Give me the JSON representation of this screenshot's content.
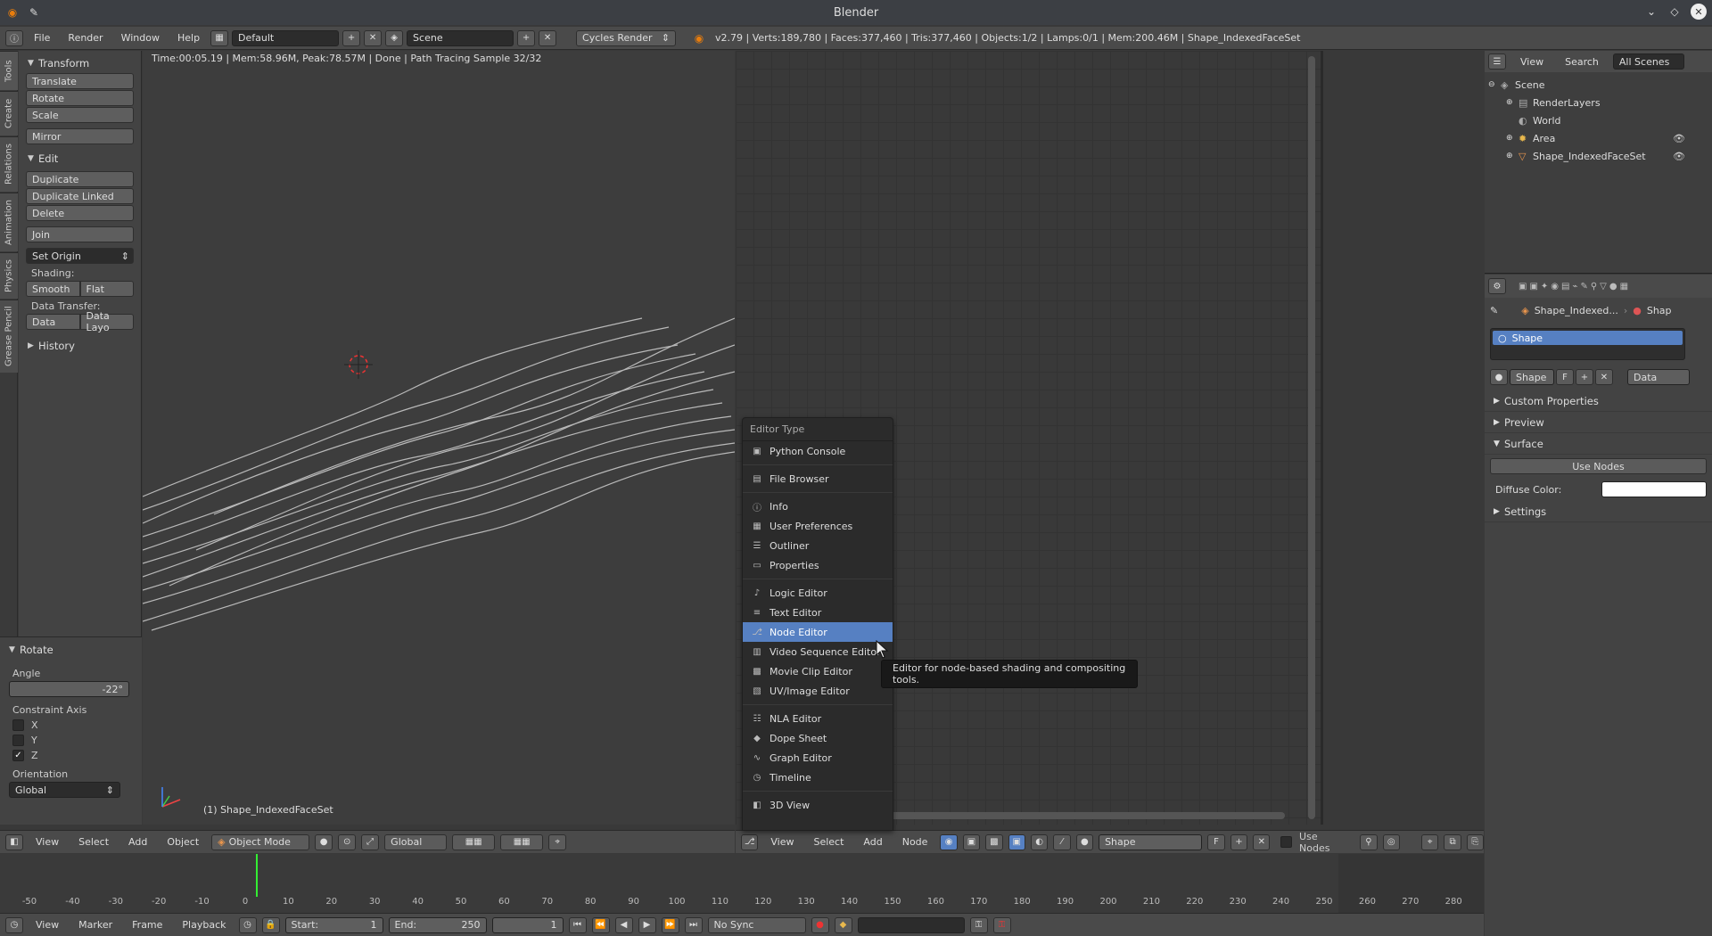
{
  "window": {
    "title": "Blender"
  },
  "menubar": {
    "items": [
      "File",
      "Render",
      "Window",
      "Help"
    ],
    "screen_layout": "Default",
    "scene": "Scene",
    "render_engine": "Cycles Render",
    "stats": "v2.79 | Verts:189,780 | Faces:377,460 | Tris:377,460 | Objects:1/2 | Lamps:0/1 | Mem:200.46M | Shape_IndexedFaceSet"
  },
  "tabs": [
    "Tools",
    "Create",
    "Relations",
    "Animation",
    "Physics",
    "Grease Pencil"
  ],
  "toolshelf": {
    "transform": {
      "title": "Transform",
      "buttons": [
        "Translate",
        "Rotate",
        "Scale",
        "Mirror"
      ]
    },
    "edit": {
      "title": "Edit",
      "buttons": [
        "Duplicate",
        "Duplicate Linked",
        "Delete",
        "Join",
        "Set Origin"
      ]
    },
    "shading_label": "Shading:",
    "shading": [
      "Smooth",
      "Flat"
    ],
    "data_transfer_label": "Data Transfer:",
    "data_transfer": [
      "Data",
      "Data Layo"
    ],
    "history": "History",
    "operator": {
      "title": "Rotate",
      "angle_label": "Angle",
      "angle_value": "-22°",
      "constraint_label": "Constraint Axis",
      "axes": [
        {
          "label": "X",
          "checked": false
        },
        {
          "label": "Y",
          "checked": false
        },
        {
          "label": "Z",
          "checked": true
        }
      ],
      "orientation_label": "Orientation",
      "orientation_value": "Global"
    }
  },
  "viewport": {
    "status": "Time:00:05.19 | Mem:58.96M, Peak:78.57M | Done | Path Tracing Sample 32/32",
    "object_name": "(1) Shape_IndexedFaceSet",
    "header": {
      "menus": [
        "View",
        "Select",
        "Add",
        "Object"
      ],
      "mode": "Object Mode",
      "orientation": "Global"
    }
  },
  "node_editor": {
    "header": {
      "menus": [
        "View",
        "Select",
        "Add",
        "Node"
      ],
      "material": "Shape",
      "f_label": "F",
      "use_nodes": "Use Nodes"
    }
  },
  "editor_menu": {
    "title": "Editor Type",
    "groups": [
      [
        {
          "label": "Python Console",
          "icon": "console-icon"
        }
      ],
      [
        {
          "label": "File Browser",
          "icon": "folder-icon"
        }
      ],
      [
        {
          "label": "Info",
          "icon": "info-icon"
        },
        {
          "label": "User Preferences",
          "icon": "preferences-icon"
        },
        {
          "label": "Outliner",
          "icon": "outliner-icon"
        },
        {
          "label": "Properties",
          "icon": "properties-icon"
        }
      ],
      [
        {
          "label": "Logic Editor",
          "icon": "logic-icon"
        },
        {
          "label": "Text Editor",
          "icon": "text-icon"
        },
        {
          "label": "Node Editor",
          "icon": "node-icon",
          "selected": true
        },
        {
          "label": "Video Sequence Editor",
          "icon": "sequence-icon"
        },
        {
          "label": "Movie Clip Editor",
          "icon": "clip-icon"
        },
        {
          "label": "UV/Image Editor",
          "icon": "image-icon"
        }
      ],
      [
        {
          "label": "NLA Editor",
          "icon": "nla-icon"
        },
        {
          "label": "Dope Sheet",
          "icon": "dopesheet-icon"
        },
        {
          "label": "Graph Editor",
          "icon": "graph-icon"
        },
        {
          "label": "Timeline",
          "icon": "timeline-icon"
        }
      ],
      [
        {
          "label": "3D View",
          "icon": "view3d-icon"
        }
      ]
    ],
    "tooltip": "Editor for node-based shading and compositing tools."
  },
  "outliner": {
    "header": {
      "view": "View",
      "search": "Search",
      "scope": "All Scenes"
    },
    "rows": [
      {
        "label": "Scene",
        "depth": 0
      },
      {
        "label": "RenderLayers",
        "depth": 1
      },
      {
        "label": "World",
        "depth": 1
      },
      {
        "label": "Area",
        "depth": 1
      },
      {
        "label": "Shape_IndexedFaceSet",
        "depth": 1
      }
    ]
  },
  "properties": {
    "breadcrumb": [
      "Shape_Indexed...",
      "Shap"
    ],
    "slot": "Shape",
    "material_name": "Shape",
    "f_label": "F",
    "link": "Data",
    "sections": {
      "custom": "Custom Properties",
      "preview": "Preview",
      "surface": "Surface",
      "settings": "Settings"
    },
    "use_nodes": "Use Nodes",
    "diffuse_label": "Diffuse Color:",
    "diffuse_color": "#ffffff"
  },
  "timeline": {
    "ticks": [
      "-50",
      "-40",
      "-30",
      "-20",
      "-10",
      "0",
      "10",
      "20",
      "30",
      "40",
      "50",
      "60",
      "70",
      "80",
      "90",
      "100",
      "110",
      "120",
      "130",
      "140",
      "150",
      "160",
      "170",
      "180",
      "190",
      "200",
      "210",
      "220",
      "230",
      "240",
      "250",
      "260",
      "270",
      "280"
    ],
    "header": {
      "menus": [
        "View",
        "Marker",
        "Frame",
        "Playback"
      ],
      "start_label": "Start:",
      "start": "1",
      "end_label": "End:",
      "end": "250",
      "current": "1",
      "sync": "No Sync"
    }
  },
  "colors": {
    "accent": "#5680c2",
    "background": "#393939",
    "panel": "#434343"
  }
}
